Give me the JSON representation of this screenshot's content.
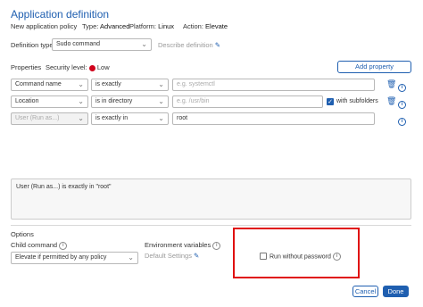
{
  "header": {
    "title": "Application definition",
    "subtitle": "New application policy",
    "type_label": "Type:",
    "type_value": "Advanced",
    "platform_label": "Platform:",
    "platform_value": "Linux",
    "action_label": "Action:",
    "action_value": "Elevate"
  },
  "definition": {
    "type_label": "Definition type:",
    "type_value": "Sudo command",
    "describe_label": "Describe definition"
  },
  "properties": {
    "label": "Properties",
    "security_label": "Security level:",
    "security_value": "Low",
    "security_color": "#d0021b",
    "add_button": "Add property",
    "rows": [
      {
        "field": "Command name",
        "operator": "is exactly",
        "value": "",
        "placeholder": "e.g. systemctl"
      },
      {
        "field": "Location",
        "operator": "is in directory",
        "value": "",
        "placeholder": "e.g. /usr/bin",
        "checkbox_label": "with subfolders",
        "checked": true
      },
      {
        "field": "User (Run as...)",
        "operator": "is exactly in",
        "value": "root",
        "placeholder": ""
      }
    ]
  },
  "summary": {
    "text": "User (Run as...) is exactly in \"root\""
  },
  "options": {
    "label": "Options",
    "child_label": "Child command",
    "child_value": "Elevate if permitted by any policy",
    "env_label": "Environment variables",
    "env_value": "Default Settings",
    "run_without_password": "Run without password"
  },
  "footer": {
    "cancel": "Cancel",
    "done": "Done"
  },
  "colors": {
    "accent": "#1f5fb0",
    "highlight_box": "#e01010"
  }
}
